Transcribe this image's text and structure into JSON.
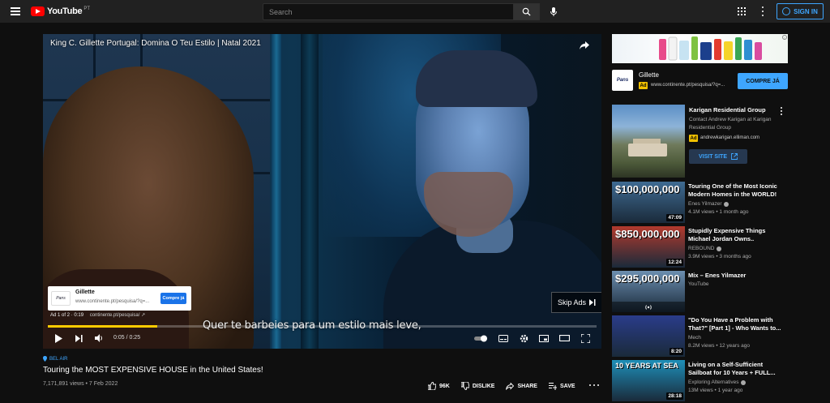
{
  "header": {
    "logo_text": "YouTube",
    "logo_region": "PT",
    "search_placeholder": "Search",
    "sign_in_label": "SIGN IN"
  },
  "player": {
    "ad_title": "King C. Gillette Portugal: Domina O Teu Estilo | Natal 2021",
    "ad_card": {
      "logo_text": "Pans",
      "name": "Gillette",
      "url": "www.continente.pt/pesquisa/?q=...",
      "button_label": "Compre já"
    },
    "ad_info": "Ad 1 of 2 · 0:19",
    "ad_info_url": "continente.pt/pesquisa/",
    "skip_label": "Skip Ads",
    "subtitle": "Quer te barbeies para um estilo mais leve,",
    "time": "0:05 / 0:25",
    "progress": 0.2
  },
  "video": {
    "location_tag": "BEL AIR",
    "title": "Touring the MOST EXPENSIVE HOUSE in the United States!",
    "stats": "7,171,891 views • 7 Feb 2022",
    "like_count": "96K",
    "dislike_label": "DISLIKE",
    "share_label": "SHARE",
    "save_label": "SAVE"
  },
  "sidebar": {
    "ad": {
      "logo_text": "Pans",
      "name": "Gillette",
      "badge": "Ad",
      "url": "www.continente.pt/pesquisa/?q=...",
      "cta": "COMPRE JÁ"
    },
    "promo": {
      "title": "Karigan Residential Group",
      "description": "Contact Andrew Karigan at Karigan Residential Group",
      "badge": "Ad",
      "url": "andrewkarigan.elliman.com",
      "button": "VISIT SITE"
    },
    "recommendations": [
      {
        "thumb_text": "$100,000,000",
        "duration": "47:09",
        "title": "Touring One of the Most Iconic Modern Homes in the WORLD!",
        "channel": "Enes Yilmazer",
        "verified": true,
        "meta": "4.1M views • 1 month ago",
        "thumb_bg": "#3f6b92"
      },
      {
        "thumb_text": "$850,000,000",
        "duration": "12:24",
        "title": "Stupidly Expensive Things Michael Jordan Owns..",
        "channel": "REBOUND",
        "verified": true,
        "meta": "3.9M views • 3 months ago",
        "thumb_bg": "#b23a2d"
      },
      {
        "thumb_text": "$295,000,000",
        "duration": "",
        "title": "Mix – Enes Yilmazer",
        "channel": "YouTube",
        "verified": false,
        "meta": "",
        "thumb_bg": "#6c8fb0"
      },
      {
        "thumb_text": "",
        "duration": "8:20",
        "title": "\"Do You Have a Problem with That?\" [Part 1] - Who Wants to...",
        "channel": "Mech",
        "verified": false,
        "meta": "8.2M views • 12 years ago",
        "thumb_bg": "#2a3c8a"
      },
      {
        "thumb_text": "10 YEARS AT SEA",
        "duration": "28:18",
        "title": "Living on a Self-Sufficient Sailboat for 10 Years + FULL...",
        "channel": "Exploring Alternatives",
        "verified": true,
        "meta": "13M views • 1 year ago",
        "thumb_bg": "#1e8fb8"
      }
    ]
  },
  "colors": {
    "accent_blue": "#3ea6ff",
    "ad_yellow": "#f2c200",
    "progress_yellow": "#ffcc00",
    "brand_red": "#ff0000"
  }
}
